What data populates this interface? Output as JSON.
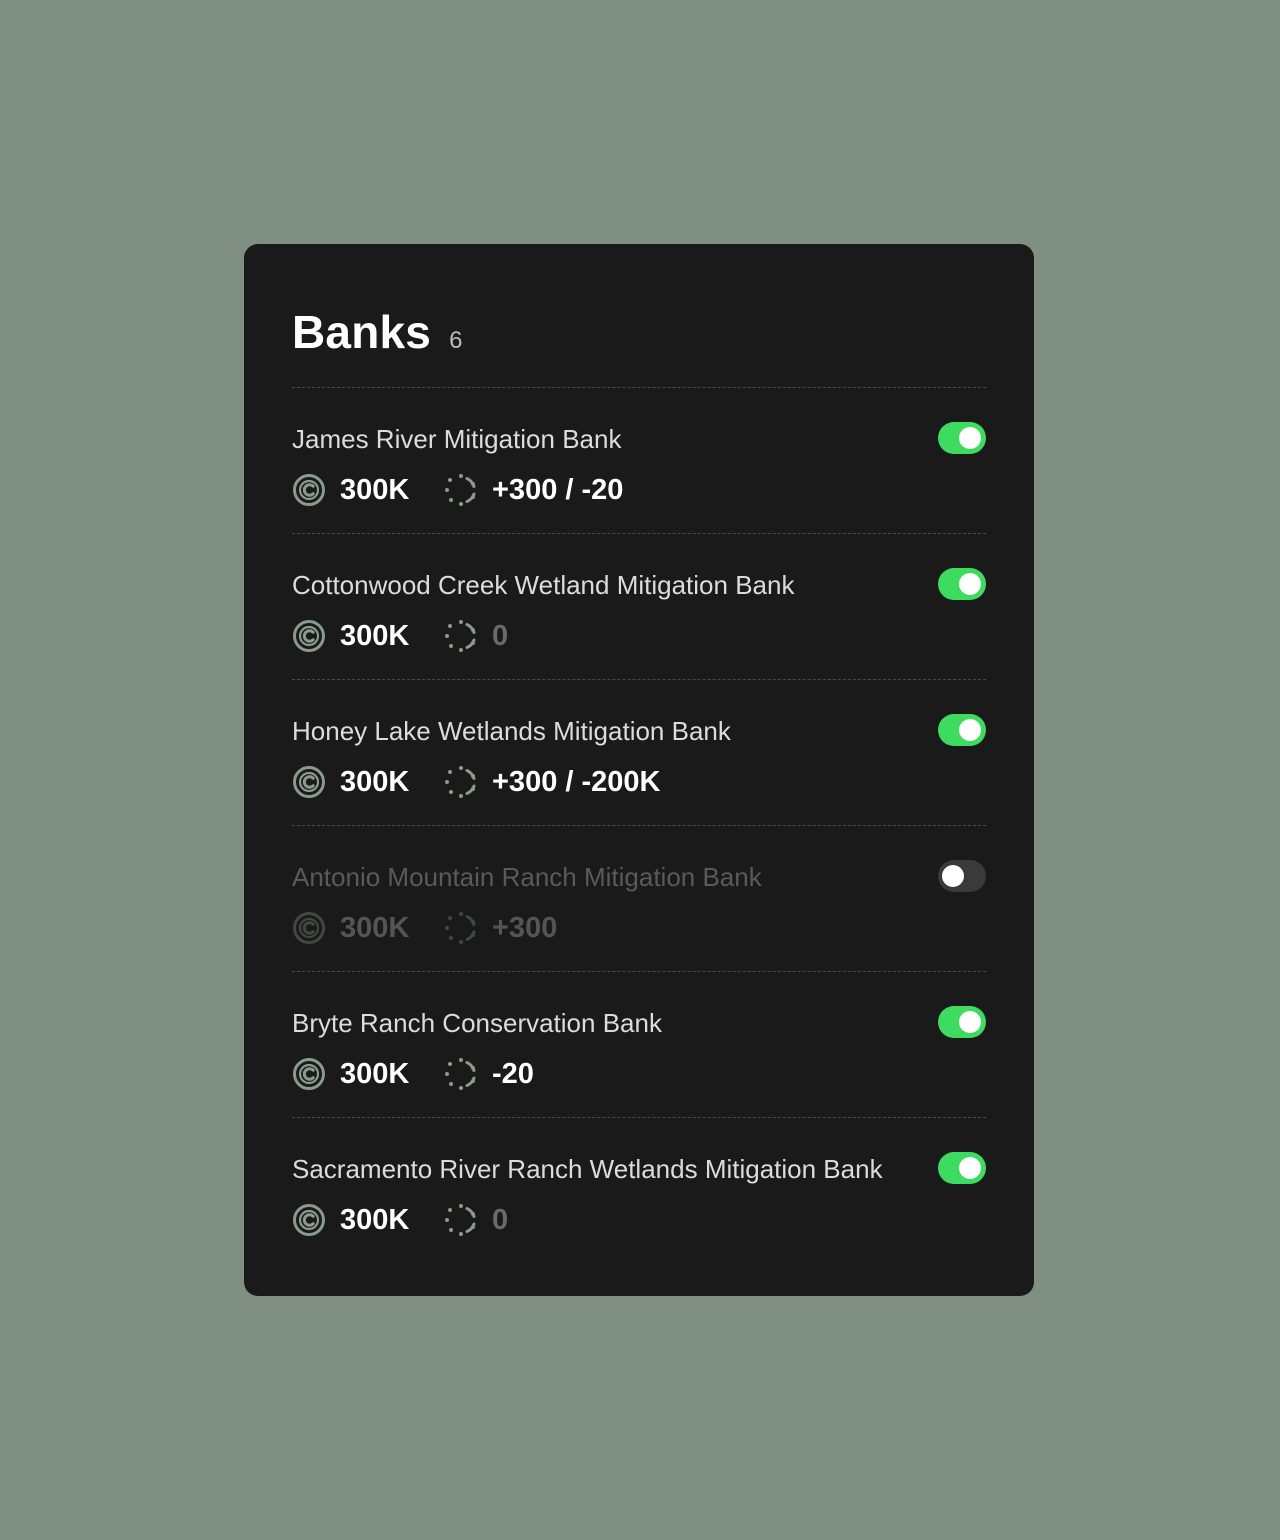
{
  "header": {
    "title": "Banks",
    "count": "6"
  },
  "colors": {
    "background": "#7f8f81",
    "card": "#1a1a1a",
    "toggle_on": "#3ddc60",
    "toggle_off": "#3a3a3a",
    "icon": "#8a9a8c"
  },
  "banks": [
    {
      "name": "James River Mitigation Bank",
      "credits": "300K",
      "change": "+300 / -20",
      "enabled": true,
      "change_muted": false
    },
    {
      "name": "Cottonwood Creek Wetland Mitigation Bank",
      "credits": "300K",
      "change": "0",
      "enabled": true,
      "change_muted": true
    },
    {
      "name": "Honey Lake Wetlands Mitigation Bank",
      "credits": "300K",
      "change": "+300 / -200K",
      "enabled": true,
      "change_muted": false
    },
    {
      "name": "Antonio Mountain Ranch Mitigation Bank",
      "credits": "300K",
      "change": "+300",
      "enabled": false,
      "change_muted": false
    },
    {
      "name": "Bryte Ranch Conservation Bank",
      "credits": "300K",
      "change": "-20",
      "enabled": true,
      "change_muted": false
    },
    {
      "name": "Sacramento River Ranch Wetlands Mitigation Bank",
      "credits": "300K",
      "change": "0",
      "enabled": true,
      "change_muted": true
    }
  ],
  "icons": {
    "credits": "credit-coin-icon",
    "change": "pending-circle-icon"
  }
}
